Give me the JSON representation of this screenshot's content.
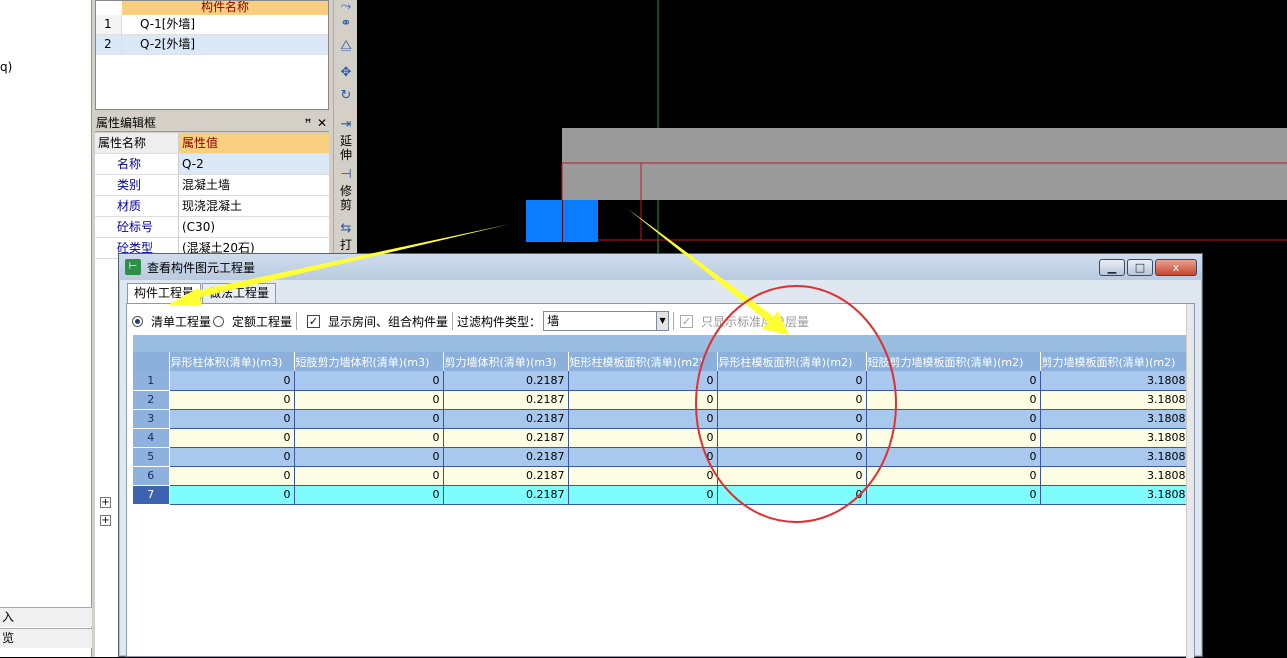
{
  "left_panel": {
    "top_fragment": "q)",
    "bottom_items": [
      "入",
      "览"
    ]
  },
  "component_list": {
    "header": "构件名称",
    "rows": [
      {
        "num": "1",
        "name": "Q-1[外墙]"
      },
      {
        "num": "2",
        "name": "Q-2[外墙]"
      }
    ]
  },
  "property_panel": {
    "title": "属性编辑框",
    "pin_icon": "pin-icon",
    "close_icon": "close-icon",
    "col_name": "属性名称",
    "col_value": "属性值",
    "rows": [
      {
        "name": "名称",
        "value": "Q-2"
      },
      {
        "name": "类别",
        "value": "混凝土墙"
      },
      {
        "name": "材质",
        "value": "现浇混凝土"
      },
      {
        "name": "砼标号",
        "value": "(C30)"
      },
      {
        "name": "砼类型",
        "value": "(混凝土20石)"
      }
    ]
  },
  "side_toolbar": {
    "extend_label": [
      "延",
      "伸"
    ],
    "trim_label": [
      "修",
      "剪"
    ],
    "print_label": "打"
  },
  "dialog": {
    "title": "查看构件图元工程量",
    "minimize": "▁",
    "maximize": "□",
    "close": "x",
    "tabs": [
      "构件工程量",
      "做法工程量"
    ],
    "radio_bill": "清单工程量",
    "radio_quota": "定额工程量",
    "show_rooms_label": "显示房间、组合构件量",
    "filter_label": "过滤构件类型：",
    "filter_value": "墙",
    "only_std_label": "只显示标准层单层量",
    "columns": [
      "异形柱体积(清单)(m3)",
      "短肢剪力墙体积(清单)(m3)",
      "剪力墙体积(清单)(m3)",
      "矩形柱模板面积(清单)(m2)",
      "异形柱模板面积(清单)(m2)",
      "短肢剪力墙模板面积(清单)(m2)",
      "剪力墙模板面积(清单)(m2)"
    ],
    "rows": [
      {
        "num": "1",
        "cells": [
          "0",
          "0",
          "0.2187",
          "0",
          "0",
          "0",
          "3.1808"
        ]
      },
      {
        "num": "2",
        "cells": [
          "0",
          "0",
          "0.2187",
          "0",
          "0",
          "0",
          "3.1808"
        ]
      },
      {
        "num": "3",
        "cells": [
          "0",
          "0",
          "0.2187",
          "0",
          "0",
          "0",
          "3.1808"
        ]
      },
      {
        "num": "4",
        "cells": [
          "0",
          "0",
          "0.2187",
          "0",
          "0",
          "0",
          "3.1808"
        ]
      },
      {
        "num": "5",
        "cells": [
          "0",
          "0",
          "0.2187",
          "0",
          "0",
          "0",
          "3.1808"
        ]
      },
      {
        "num": "6",
        "cells": [
          "0",
          "0",
          "0.2187",
          "0",
          "0",
          "0",
          "3.1808"
        ]
      },
      {
        "num": "7",
        "cells": [
          "0",
          "0",
          "0.2187",
          "0",
          "0",
          "0",
          "3.1808"
        ]
      }
    ]
  },
  "colors": {
    "annotation_arrow": "#ffff33",
    "annotation_circle": "#e03030",
    "selected_wall": "#0a7cff",
    "wall_body": "#9a9a9a",
    "axis_line": "#1fa21f"
  }
}
